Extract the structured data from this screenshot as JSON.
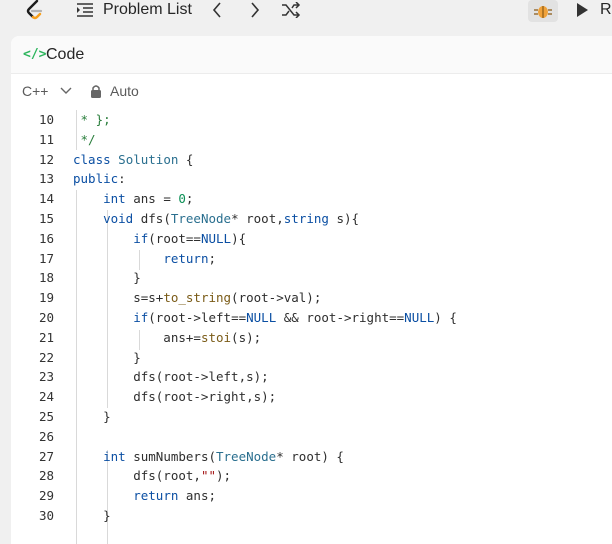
{
  "topbar": {
    "problem_list_label": "Problem List",
    "run_label": "R"
  },
  "panel": {
    "title": "Code",
    "language": "C++",
    "mode": "Auto"
  },
  "editor": {
    "lines": [
      {
        "n": "10",
        "code": " * };"
      },
      {
        "n": "11",
        "code": " */"
      },
      {
        "n": "12",
        "code": "class Solution {"
      },
      {
        "n": "13",
        "code": "public:"
      },
      {
        "n": "14",
        "code": "    int ans = 0;"
      },
      {
        "n": "15",
        "code": "    void dfs(TreeNode* root,string s){"
      },
      {
        "n": "16",
        "code": "        if(root==NULL){"
      },
      {
        "n": "17",
        "code": "            return;"
      },
      {
        "n": "18",
        "code": "        }"
      },
      {
        "n": "19",
        "code": "        s=s+to_string(root->val);"
      },
      {
        "n": "20",
        "code": "        if(root->left==NULL && root->right==NULL) {"
      },
      {
        "n": "21",
        "code": "            ans+=stoi(s);"
      },
      {
        "n": "22",
        "code": "        }"
      },
      {
        "n": "23",
        "code": "        dfs(root->left,s);"
      },
      {
        "n": "24",
        "code": "        dfs(root->right,s);"
      },
      {
        "n": "25",
        "code": "    }"
      },
      {
        "n": "26",
        "code": ""
      },
      {
        "n": "27",
        "code": "    int sumNumbers(TreeNode* root) {"
      },
      {
        "n": "28",
        "code": "        dfs(root,\"\");"
      },
      {
        "n": "29",
        "code": "        return ans;"
      },
      {
        "n": "30",
        "code": "    }"
      }
    ]
  },
  "colors": {
    "accent_green": "#2db55d",
    "keyword": "#0b4fa3",
    "number": "#0a8f55",
    "string": "#a31515",
    "comment": "#2a7e3c"
  }
}
